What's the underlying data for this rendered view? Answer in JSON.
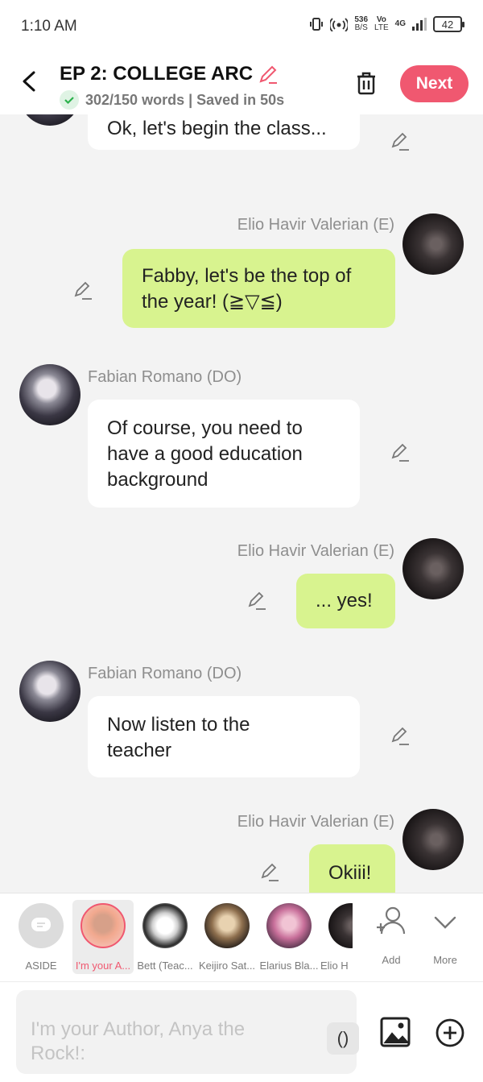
{
  "status": {
    "time": "1:10 AM",
    "speed_top": "536",
    "speed_bottom": "B/S",
    "volte_top": "Vo",
    "volte_bottom": "LTE",
    "network": "4G",
    "battery": "42"
  },
  "header": {
    "title": "EP 2: COLLEGE ARC",
    "word_status": "302/150 words | Saved in 50s",
    "next_label": "Next",
    "accent": "#f05870"
  },
  "messages": [
    {
      "speaker": "",
      "text": "Ok, let's begin the class...",
      "side": "left"
    },
    {
      "speaker": "Elio Havir Valerian (E)",
      "text": "Fabby, let's be the top of the year! (≧▽≦)",
      "side": "right"
    },
    {
      "speaker": "Fabian Romano (DO)",
      "text": "Of course, you need to have a good education background",
      "side": "left"
    },
    {
      "speaker": "Elio Havir Valerian (E)",
      "text": "... yes!",
      "side": "right"
    },
    {
      "speaker": "Fabian Romano (DO)",
      "text": "Now listen to the teacher",
      "side": "left"
    },
    {
      "speaker": "Elio Havir Valerian (E)",
      "text": "Okiii!",
      "side": "right"
    }
  ],
  "characters": [
    {
      "label": "ASIDE",
      "selected": false
    },
    {
      "label": "I'm your A...",
      "selected": true
    },
    {
      "label": "Bett (Teac...",
      "selected": false
    },
    {
      "label": "Keijiro Sat...",
      "selected": false
    },
    {
      "label": "Elarius Bla...",
      "selected": false
    },
    {
      "label": "Elio H",
      "selected": false
    }
  ],
  "actions": {
    "add_label": "Add",
    "more_label": "More"
  },
  "composer": {
    "placeholder": "I'm your Author, Anya the Rock!:",
    "paren_label": "()"
  }
}
